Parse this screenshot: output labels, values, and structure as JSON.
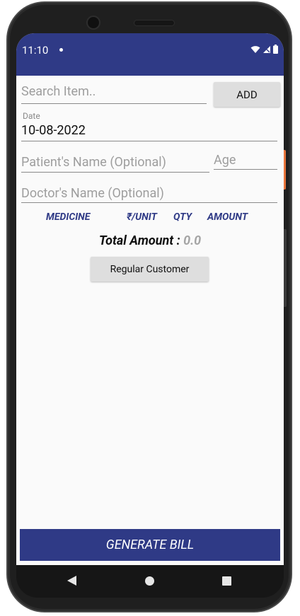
{
  "status_bar": {
    "time": "11:10",
    "icons": [
      "notification-dot-icon",
      "wifi-icon",
      "signal-icon",
      "battery-icon"
    ]
  },
  "search": {
    "placeholder": "Search Item..",
    "value": "",
    "add_label": "ADD"
  },
  "date": {
    "label": "Date",
    "value": "10-08-2022"
  },
  "patient": {
    "name_placeholder": "Patient's Name (Optional)",
    "name_value": "",
    "age_placeholder": "Age",
    "age_value": ""
  },
  "doctor": {
    "name_placeholder": "Doctor's Name (Optional)",
    "name_value": ""
  },
  "table": {
    "columns": [
      "MEDICINE",
      "₹/UNIT",
      "QTY",
      "AMOUNT"
    ]
  },
  "total": {
    "label": "Total Amount : ",
    "value": "0.0"
  },
  "regular_customer_label": "Regular Customer",
  "generate_bill_label": "GENERATE BILL",
  "colors": {
    "primary": "#2f3a86",
    "button_gray": "#dedede",
    "muted_text": "#a5a5a5"
  }
}
